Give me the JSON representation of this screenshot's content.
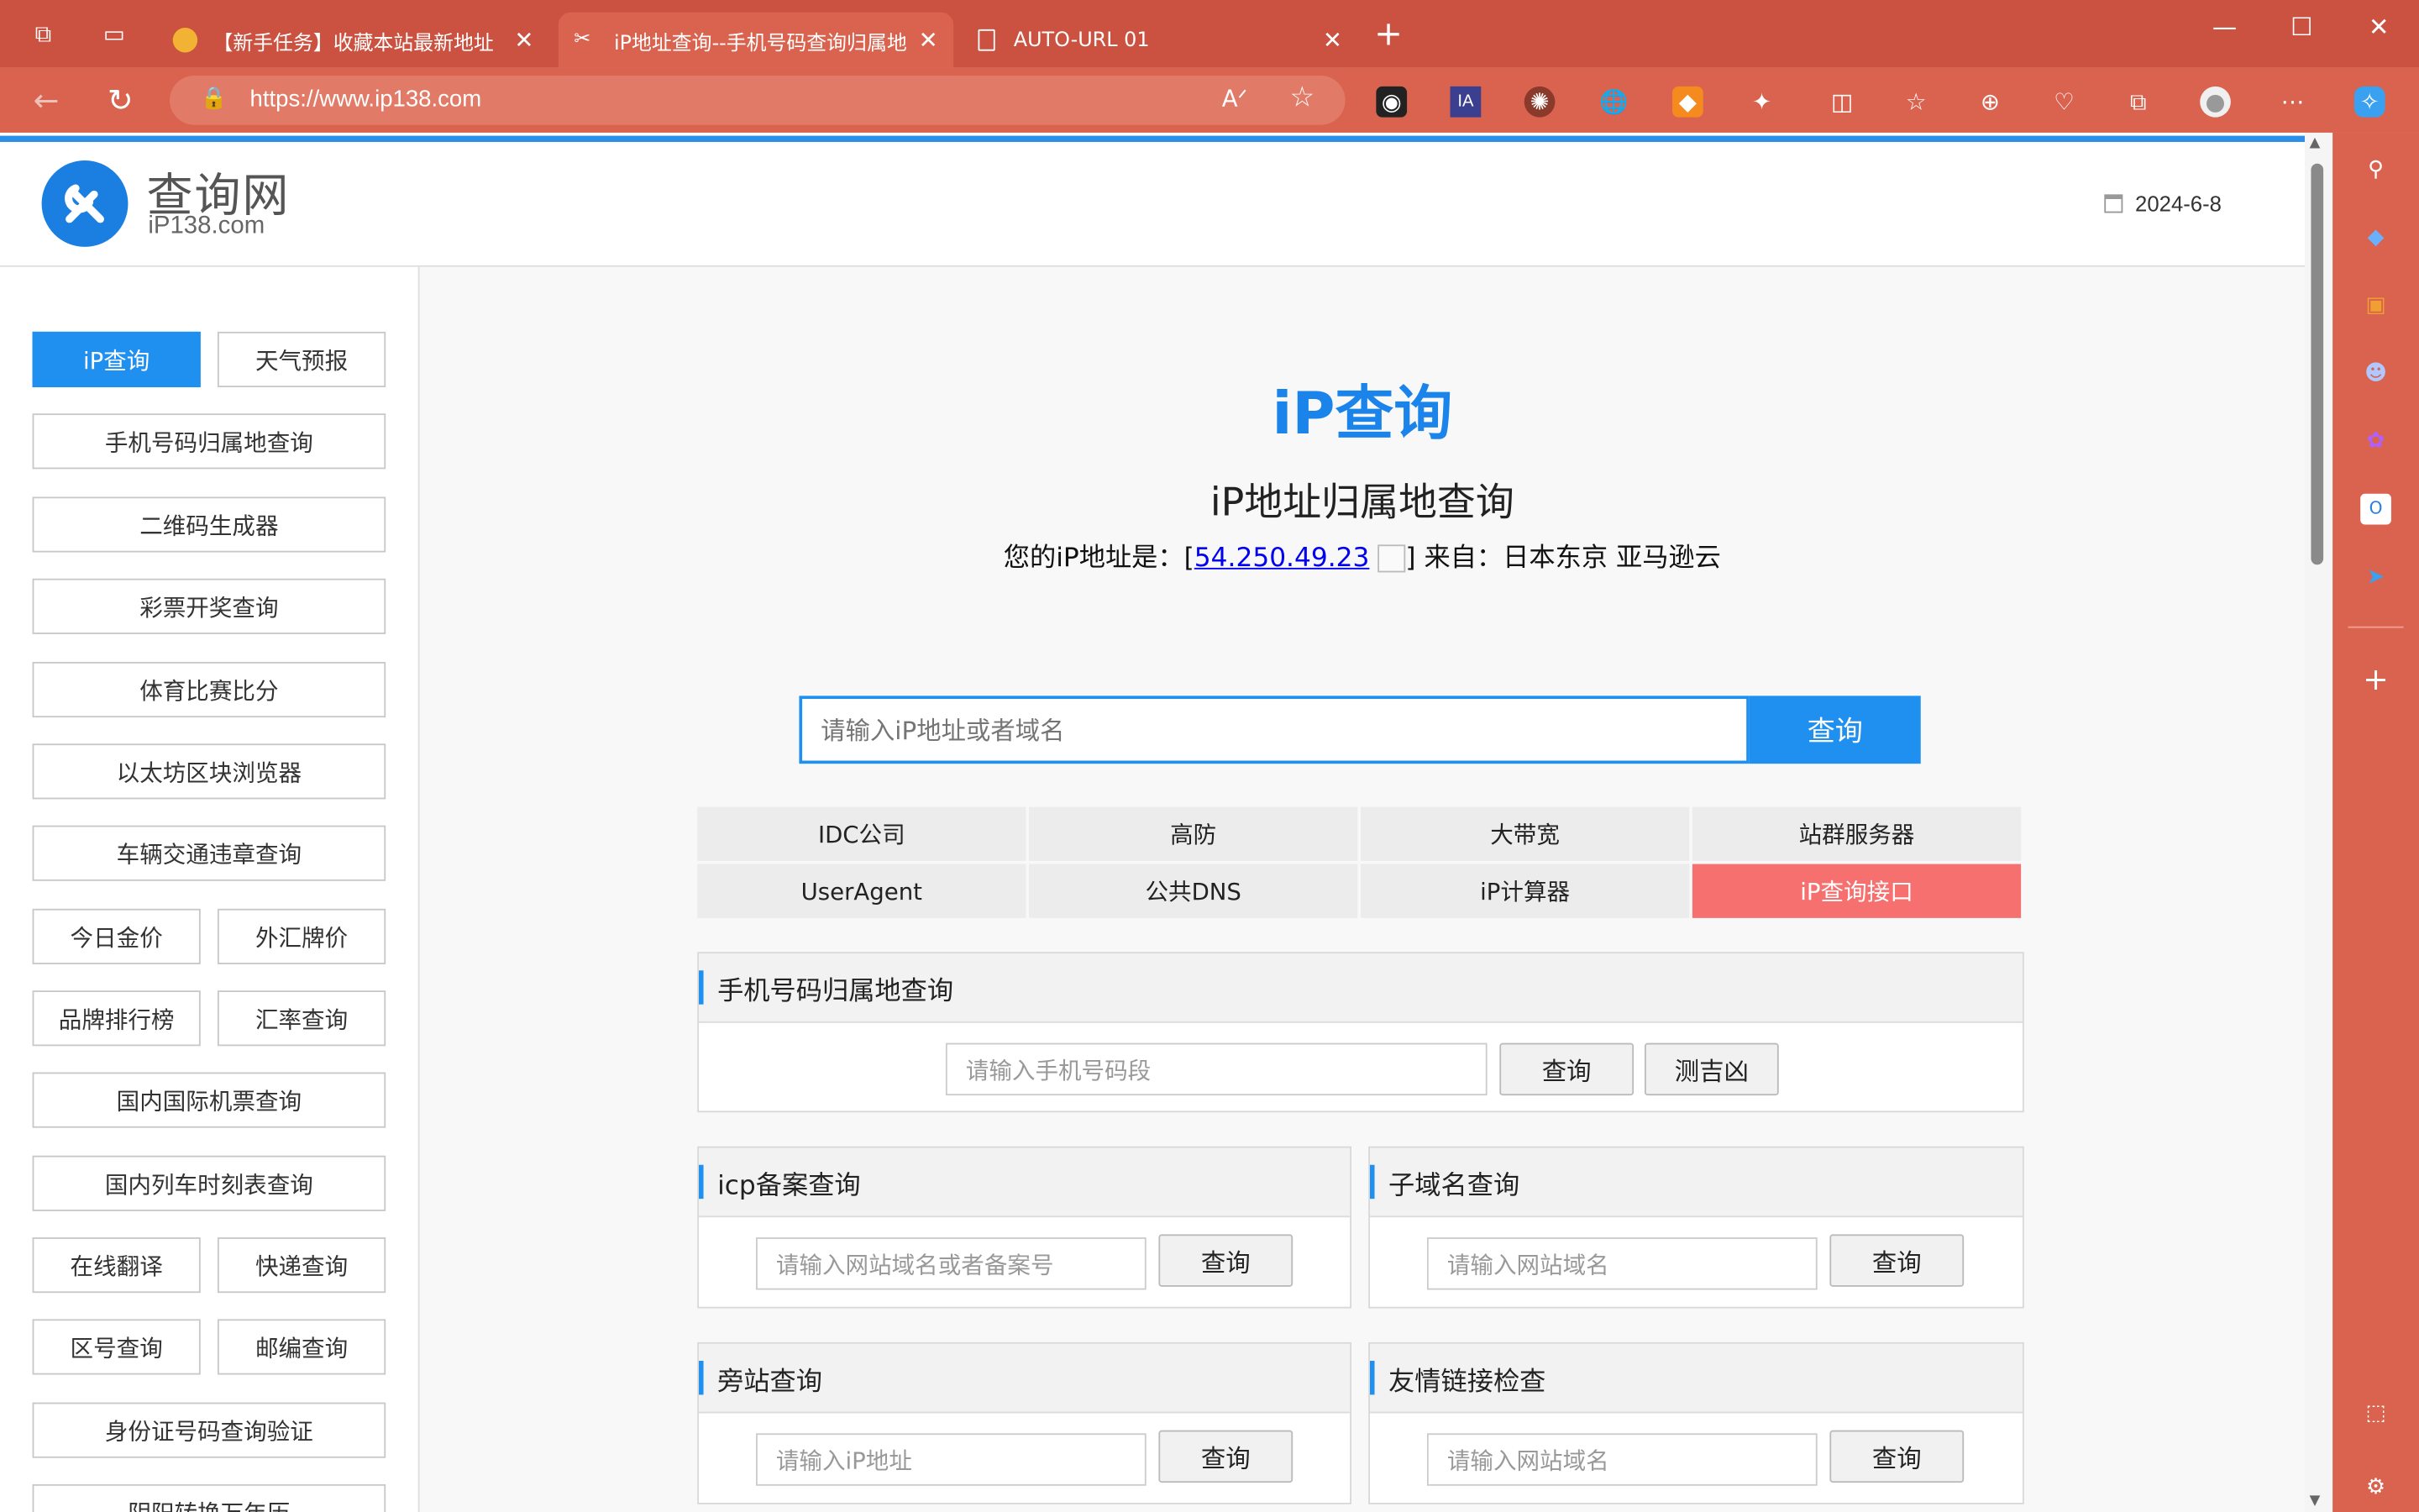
{
  "browser": {
    "tabs": [
      {
        "title": "【新手任务】收藏本站最新地址"
      },
      {
        "title": "iP地址查询--手机号码查询归属地"
      },
      {
        "title": "AUTO-URL 01"
      }
    ],
    "url": "https://www.ip138.com",
    "extensions": [
      "ext-reader",
      "ext-ia",
      "ext-seal",
      "ext-globe",
      "ext-orange"
    ],
    "accent": "#cb5240"
  },
  "header": {
    "logo_cn": "查询网",
    "logo_en": "iP138.com",
    "date": "2024-6-8"
  },
  "sidebar": {
    "items": [
      {
        "label": "iP查询"
      },
      {
        "label": "天气预报"
      },
      {
        "label": "手机号码归属地查询"
      },
      {
        "label": "二维码生成器"
      },
      {
        "label": "彩票开奖查询"
      },
      {
        "label": "体育比赛比分"
      },
      {
        "label": "以太坊区块浏览器"
      },
      {
        "label": "车辆交通违章查询"
      },
      {
        "label": "今日金价"
      },
      {
        "label": "外汇牌价"
      },
      {
        "label": "品牌排行榜"
      },
      {
        "label": "汇率查询"
      },
      {
        "label": "国内国际机票查询"
      },
      {
        "label": "国内列车时刻表查询"
      },
      {
        "label": "在线翻译"
      },
      {
        "label": "快递查询"
      },
      {
        "label": "区号查询"
      },
      {
        "label": "邮编查询"
      },
      {
        "label": "身份证号码查询验证"
      },
      {
        "label": "阴阳转换万年历"
      }
    ]
  },
  "main": {
    "title": "iP查询",
    "subtitle": "iP地址归属地查询",
    "ip_prefix": "您的iP地址是：[",
    "ip": "54.250.49.23",
    "ip_suffix": "] 来自：日本东京 亚马逊云",
    "search": {
      "placeholder": "请输入iP地址或者域名",
      "button": "查询"
    },
    "links": [
      {
        "label": "IDC公司"
      },
      {
        "label": "高防"
      },
      {
        "label": "大带宽"
      },
      {
        "label": "站群服务器"
      },
      {
        "label": "UserAgent"
      },
      {
        "label": "公共DNS"
      },
      {
        "label": "iP计算器"
      },
      {
        "label": "iP查询接口"
      }
    ],
    "phone_panel": {
      "title": "手机号码归属地查询",
      "placeholder": "请输入手机号码段",
      "button": "查询",
      "button2": "测吉凶"
    },
    "icp_panel": {
      "title": "icp备案查询",
      "placeholder": "请输入网站域名或者备案号",
      "button": "查询"
    },
    "subdomain_panel": {
      "title": "子域名查询",
      "placeholder": "请输入网站域名",
      "button": "查询"
    },
    "sidesite_panel": {
      "title": "旁站查询",
      "placeholder": "请输入iP地址",
      "button": "查询"
    },
    "friendlink_panel": {
      "title": "友情链接检查",
      "placeholder": "请输入网站域名",
      "button": "查询"
    }
  }
}
